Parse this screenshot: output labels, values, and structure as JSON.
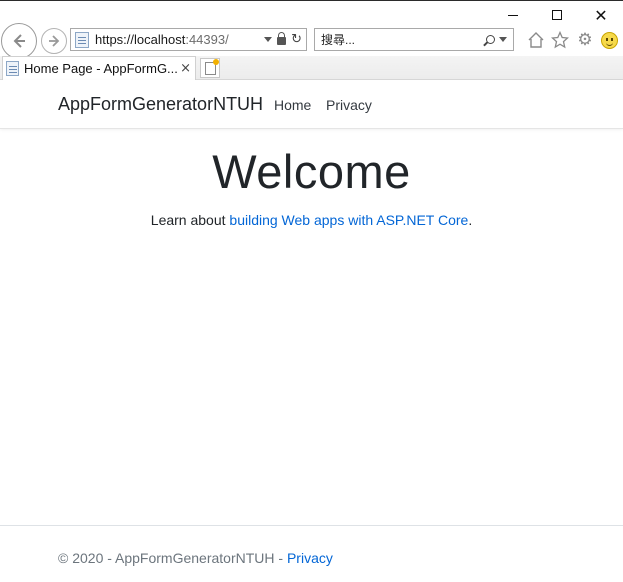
{
  "browser": {
    "url_host": "https://localhost",
    "url_port": ":44393/",
    "search_placeholder": "搜尋...",
    "tab_title": "Home Page - AppFormG...",
    "tab_close": "×",
    "window_controls": {
      "close": "✕"
    },
    "icons": [
      "back-icon",
      "forward-icon",
      "page-icon",
      "dropdown-icon",
      "lock-icon",
      "refresh-icon",
      "search-icon",
      "home-icon",
      "star-icon",
      "gear-icon",
      "smiley-icon",
      "new-tab-icon"
    ]
  },
  "navbar": {
    "brand": "AppFormGeneratorNTUH",
    "links": [
      {
        "label": "Home"
      },
      {
        "label": "Privacy"
      }
    ]
  },
  "main": {
    "title": "Welcome",
    "text_before": "Learn about ",
    "link_text": "building Web apps with ASP.NET Core",
    "text_after": "."
  },
  "footer": {
    "text": "© 2020 - AppFormGeneratorNTUH - ",
    "link": "Privacy"
  },
  "colors": {
    "link": "#0366d6",
    "text": "#212529",
    "muted": "#6c757d"
  }
}
